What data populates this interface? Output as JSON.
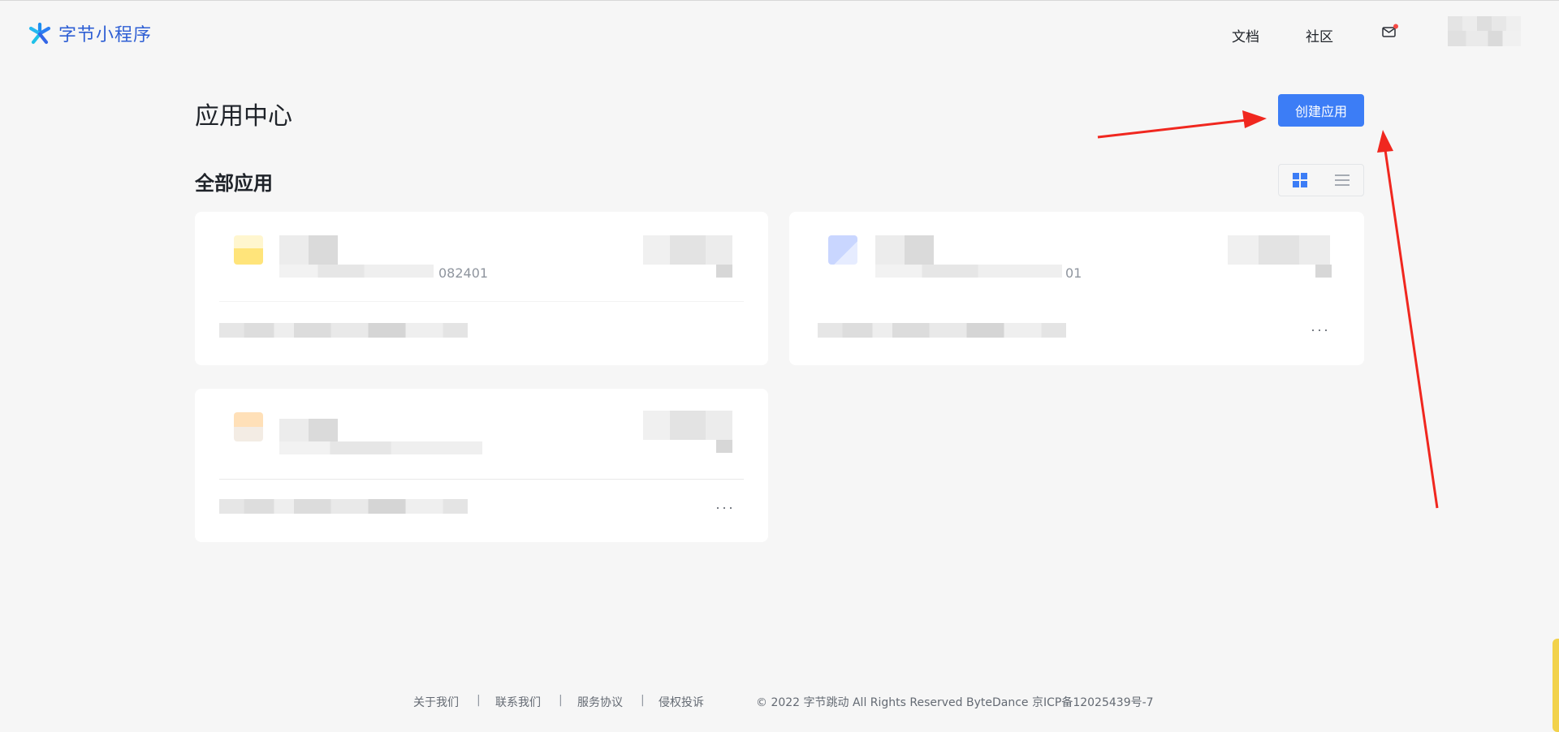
{
  "header": {
    "logo_text": "字节小程序",
    "nav": {
      "docs": "文档",
      "community": "社区"
    },
    "mail_has_unread": true
  },
  "main": {
    "title": "应用中心",
    "create_button": "创建应用",
    "section_title": "全部应用",
    "view_modes": [
      "grid",
      "list"
    ],
    "active_view": "grid"
  },
  "cards": [
    {
      "id_fragment": "082401",
      "icon_color": "#ffe47a",
      "has_more": false
    },
    {
      "id_fragment": "01",
      "icon_color": "#c9d6ff",
      "has_more": true,
      "more": "···"
    },
    {
      "id_fragment": "",
      "icon_color": "#ffe0b8",
      "has_more": true,
      "more": "···"
    }
  ],
  "footer": {
    "links": [
      "关于我们",
      "联系我们",
      "服务协议",
      "侵权投诉"
    ],
    "separator": "|",
    "copyright": "© 2022 字节跳动 All Rights Reserved ByteDance 京ICP备12025439号-7"
  },
  "colors": {
    "primary": "#3c7df6",
    "brand": "#2e5fd4",
    "annotation_arrow": "#f0271f",
    "background": "#f6f6f6"
  },
  "icons": [
    "logo-star-icon",
    "mail-icon",
    "grid-view-icon",
    "list-view-icon"
  ]
}
